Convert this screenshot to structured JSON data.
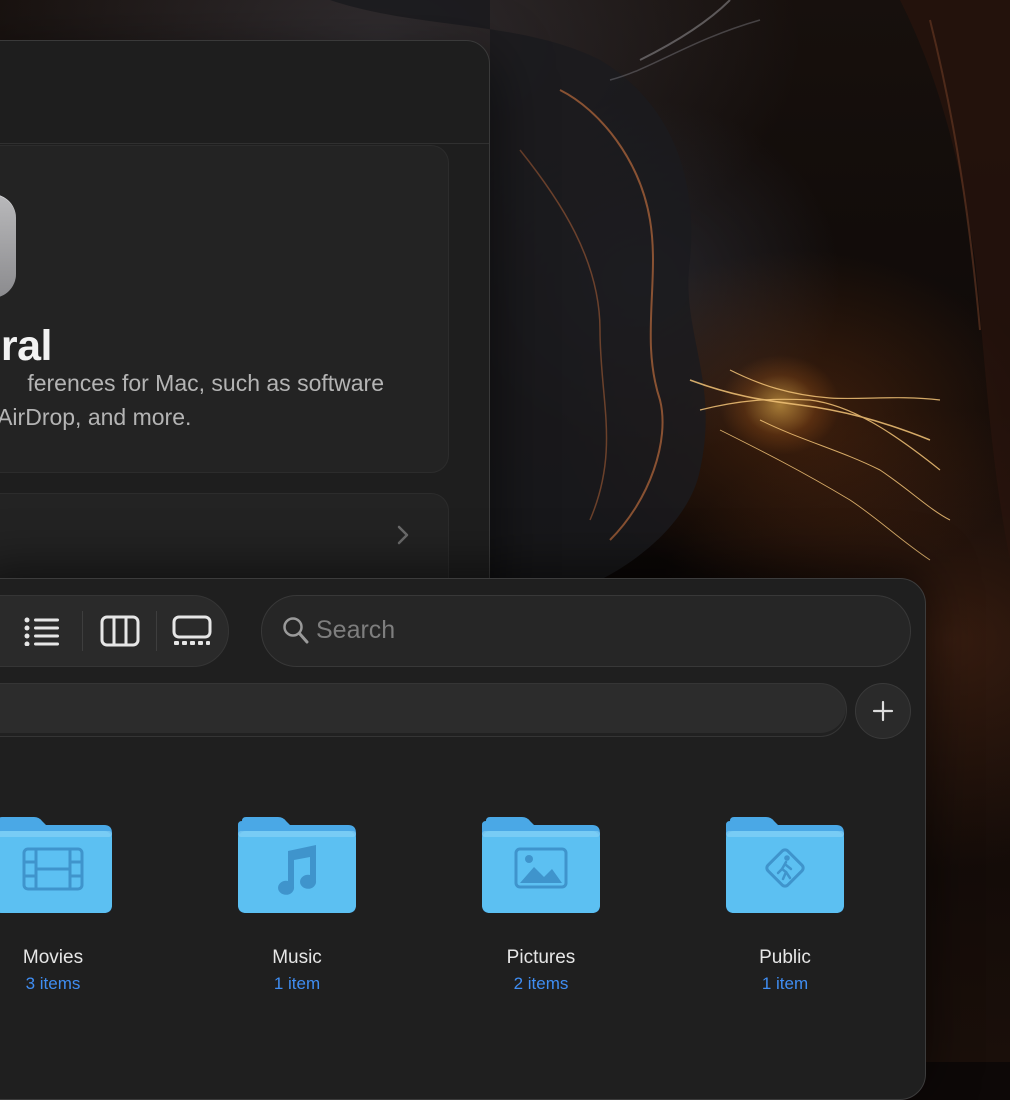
{
  "settings": {
    "general_title": "eral",
    "general_desc_line1": "ferences for Mac, such as software",
    "general_desc_line2": "ge, AirDrop, and more."
  },
  "finder": {
    "search_placeholder": "Search",
    "view_buttons": [
      "list-view",
      "column-view",
      "gallery-view"
    ],
    "folders": [
      {
        "name": "Movies",
        "count": "3 items",
        "icon": "film-icon"
      },
      {
        "name": "Music",
        "count": "1 item",
        "icon": "music-note-icon"
      },
      {
        "name": "Pictures",
        "count": "2 items",
        "icon": "photo-icon"
      },
      {
        "name": "Public",
        "count": "1 item",
        "icon": "public-sign-icon"
      }
    ]
  },
  "colors": {
    "folder_blue": "#5ab8ee",
    "link_blue": "#3f8df2",
    "window_bg": "#1f1f1f"
  }
}
